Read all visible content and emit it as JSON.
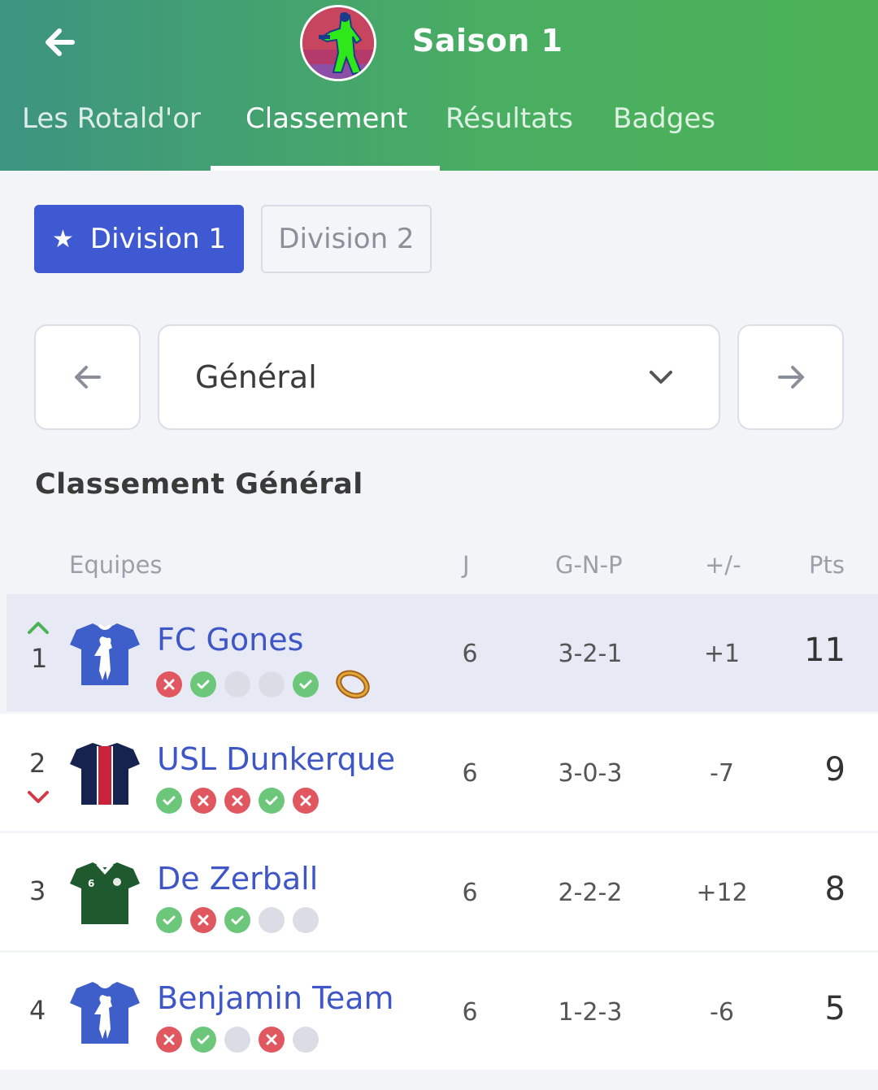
{
  "header": {
    "title": "Saison 1",
    "tabs": [
      {
        "label": "Les Rotald'or",
        "active": false
      },
      {
        "label": "Classement",
        "active": true
      },
      {
        "label": "Résultats",
        "active": false
      },
      {
        "label": "Badges",
        "active": false
      }
    ]
  },
  "divisions": [
    {
      "label": "Division 1",
      "active": true,
      "icon": "star-icon"
    },
    {
      "label": "Division 2",
      "active": false
    }
  ],
  "filter": {
    "selected": "Général"
  },
  "section_title": "Classement Général",
  "table": {
    "headers": {
      "team": "Equipes",
      "j": "J",
      "gnp": "G-N-P",
      "diff": "+/-",
      "pts": "Pts"
    },
    "rows": [
      {
        "rank": "1",
        "trend": "up",
        "team": "FC Gones",
        "j": "6",
        "gnp": "3-2-1",
        "diff": "+1",
        "pts": "11",
        "form": [
          "L",
          "W",
          "N",
          "N",
          "W"
        ],
        "badge": "ring-icon",
        "shirt": "blue-goat"
      },
      {
        "rank": "2",
        "trend": "down",
        "team": "USL Dunkerque",
        "j": "6",
        "gnp": "3-0-3",
        "diff": "-7",
        "pts": "9",
        "form": [
          "W",
          "L",
          "L",
          "W",
          "L"
        ],
        "shirt": "navy-red"
      },
      {
        "rank": "3",
        "trend": "",
        "team": "De Zerball",
        "j": "6",
        "gnp": "2-2-2",
        "diff": "+12",
        "pts": "8",
        "form": [
          "W",
          "L",
          "W",
          "N",
          "N"
        ],
        "shirt": "green"
      },
      {
        "rank": "4",
        "trend": "",
        "team": "Benjamin Team",
        "j": "6",
        "gnp": "1-2-3",
        "diff": "-6",
        "pts": "5",
        "form": [
          "L",
          "W",
          "N",
          "L",
          "N"
        ],
        "shirt": "blue-goat"
      }
    ]
  },
  "colors": {
    "header_start": "#3d9480",
    "header_end": "#4bb356",
    "accent": "#3f59d3",
    "team_link": "#3f57c6",
    "win": "#6cc77b",
    "loss": "#e05760",
    "none": "#dadce6"
  }
}
